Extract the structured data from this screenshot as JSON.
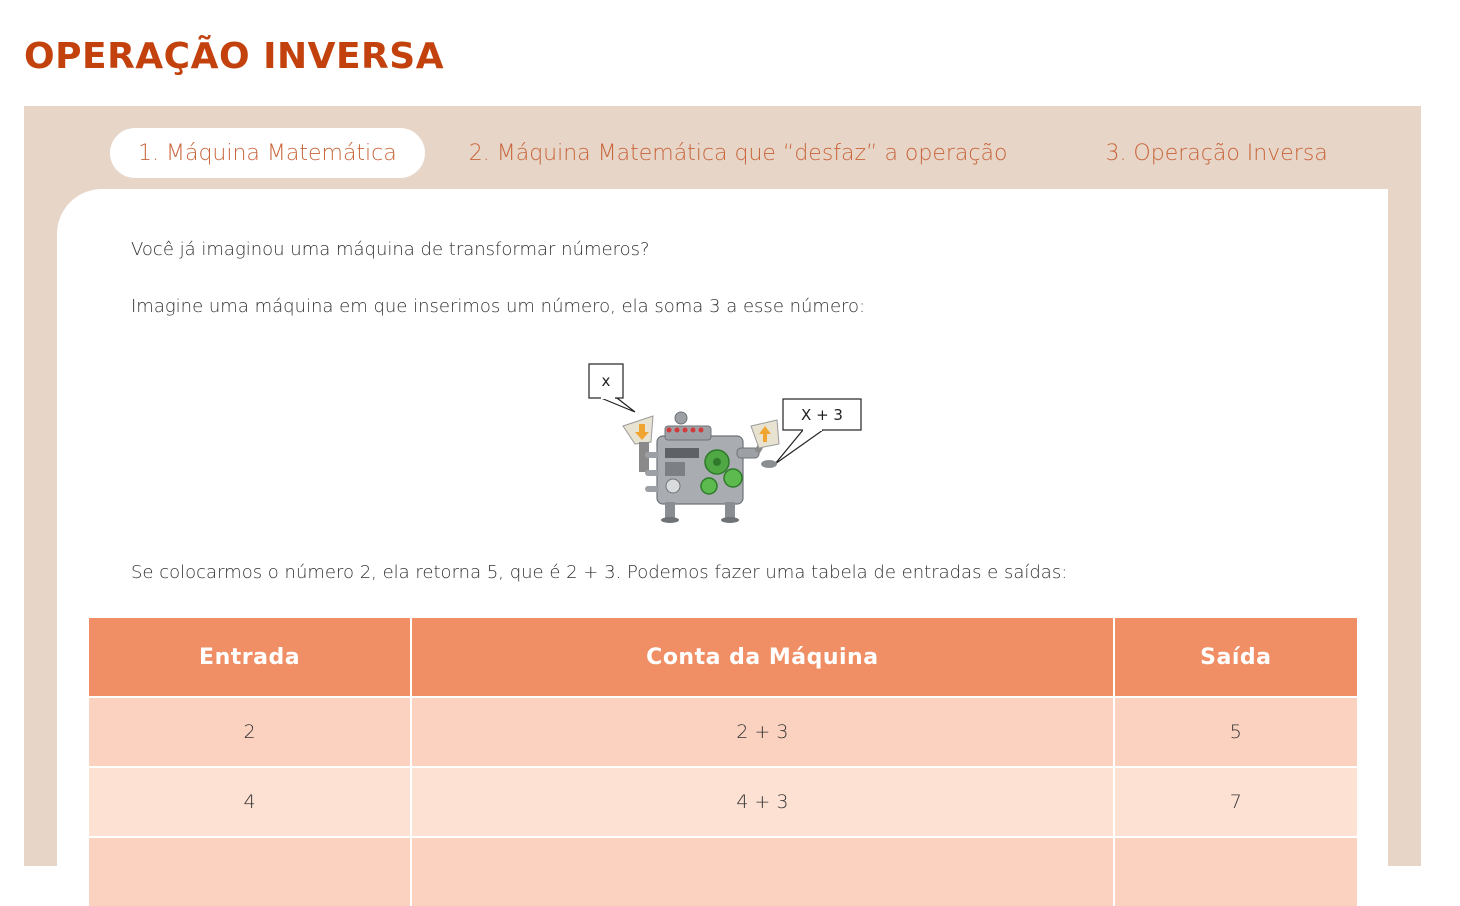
{
  "page": {
    "title": "OPERAÇÃO INVERSA"
  },
  "tabs": [
    {
      "label": "1. Máquina Matemática",
      "active": true
    },
    {
      "label": "2. Máquina Matemática que “desfaz” a operação",
      "active": false
    },
    {
      "label": "3. Operação Inversa",
      "active": false
    }
  ],
  "content": {
    "paragraph_1": "Você já imaginou uma máquina de transformar números?",
    "paragraph_2": "Imagine uma máquina em que inserimos um número, ela soma 3 a esse número:",
    "paragraph_3": "Se colocarmos o número 2, ela retorna 5, que é 2 + 3. Podemos fazer uma tabela de entradas e saídas:"
  },
  "figure": {
    "input_label": "x",
    "output_label": "X + 3"
  },
  "table": {
    "headers": [
      "Entrada",
      "Conta da Máquina",
      "Saída"
    ],
    "rows": [
      [
        "2",
        "2 + 3",
        "5"
      ],
      [
        "4",
        "4 + 3",
        "7"
      ],
      [
        "",
        "",
        ""
      ]
    ]
  },
  "colors": {
    "title": "#c2410c",
    "tab_text": "#c8653a",
    "panel_bg": "#e7d5c8",
    "table_header": "#f08f66",
    "row_dark": "#fbd2bf",
    "row_light": "#fde1d3"
  }
}
